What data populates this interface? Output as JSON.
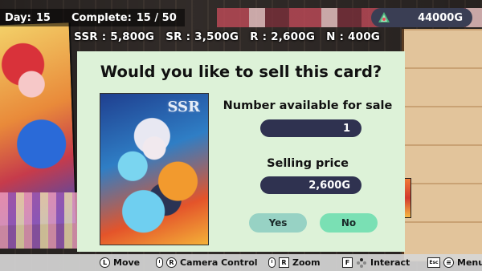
{
  "hud": {
    "day_label": "Day:",
    "day_value": "15",
    "complete_label": "Complete:",
    "complete_value": "15 / 50",
    "money": "44000G"
  },
  "price_list": [
    {
      "rarity": "SSR",
      "text": "SSR : 5,800G"
    },
    {
      "rarity": "SR",
      "text": "SR : 3,500G"
    },
    {
      "rarity": "R",
      "text": "R : 2,600G"
    },
    {
      "rarity": "N",
      "text": "N : 400G"
    }
  ],
  "dialog": {
    "title": "Would you like to sell this card?",
    "card_rarity_mark": "SSR",
    "available_label": "Number available for sale",
    "available_value": "1",
    "price_label": "Selling price",
    "price_value": "2,600G",
    "yes_label": "Yes",
    "no_label": "No"
  },
  "controls": [
    {
      "key": "L",
      "label": "Move"
    },
    {
      "key": "R",
      "label": "Camera Control"
    },
    {
      "key": "R",
      "label": "Zoom"
    },
    {
      "key": "F",
      "label": "Interact"
    },
    {
      "key": "Esc",
      "label": "Menu"
    }
  ],
  "colors": {
    "dialog_bg": "#ddf2d8",
    "value_pill": "#2f3250",
    "yes_button": "#97d2c4",
    "no_button": "#7ae0b4",
    "money_pill": "#3a3e54"
  }
}
